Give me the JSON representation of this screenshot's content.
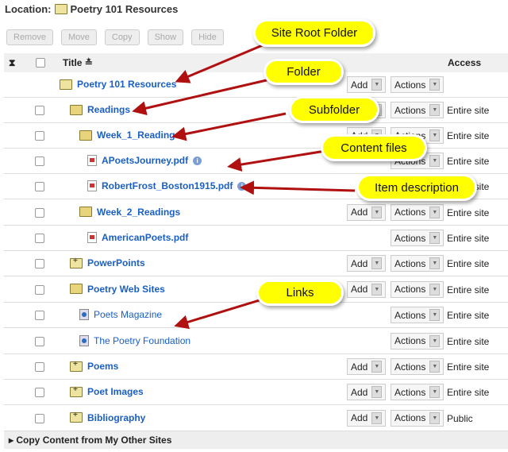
{
  "location": {
    "label": "Location:",
    "value": "Poetry 101 Resources"
  },
  "toolbar": [
    "Remove",
    "Move",
    "Copy",
    "Show",
    "Hide"
  ],
  "header": {
    "title": "Title",
    "access": "Access"
  },
  "add_label": "Add",
  "actions_label": "Actions",
  "rows": [
    {
      "title": "Poetry 101 Resources",
      "icon": "folder",
      "level": 0,
      "add": true,
      "access": ""
    },
    {
      "title": "Readings",
      "icon": "folder-open",
      "level": 1,
      "add": true,
      "access": "Entire site"
    },
    {
      "title": "Week_1_Readings",
      "icon": "folder-open",
      "level": 2,
      "add": true,
      "access": "Entire site"
    },
    {
      "title": "APoetsJourney.pdf",
      "icon": "pdf",
      "level": 3,
      "add": false,
      "info": true,
      "access": "Entire site"
    },
    {
      "title": "RobertFrost_Boston1915.pdf",
      "icon": "pdf",
      "level": 3,
      "add": false,
      "info": true,
      "access": "Entire site"
    },
    {
      "title": "Week_2_Readings",
      "icon": "folder-open",
      "level": 2,
      "add": true,
      "access": "Entire site"
    },
    {
      "title": "AmericanPoets.pdf",
      "icon": "pdf",
      "level": 3,
      "add": false,
      "access": "Entire site"
    },
    {
      "title": "PowerPoints",
      "icon": "folder-plus",
      "level": 1,
      "add": true,
      "access": "Entire site"
    },
    {
      "title": "Poetry Web Sites",
      "icon": "folder-open",
      "level": 1,
      "add": true,
      "access": "Entire site"
    },
    {
      "title": "Poets Magazine",
      "icon": "weblink",
      "level": 2,
      "add": false,
      "access": "Entire site"
    },
    {
      "title": "The Poetry Foundation",
      "icon": "weblink",
      "level": 2,
      "add": false,
      "access": "Entire site"
    },
    {
      "title": "Poems",
      "icon": "folder-plus",
      "level": 1,
      "add": true,
      "access": "Entire site"
    },
    {
      "title": "Poet Images",
      "icon": "folder-plus",
      "level": 1,
      "add": true,
      "access": "Entire site"
    },
    {
      "title": "Bibliography",
      "icon": "folder-plus",
      "level": 1,
      "add": true,
      "access": "Public"
    }
  ],
  "footer": "Copy Content from My Other Sites",
  "callouts": [
    "Site Root Folder",
    "Folder",
    "Subfolder",
    "Content files",
    "Item description",
    "Links"
  ],
  "colors": {
    "link": "#1a5fc4",
    "callout": "#ffff00",
    "arrow": "#b01010"
  }
}
